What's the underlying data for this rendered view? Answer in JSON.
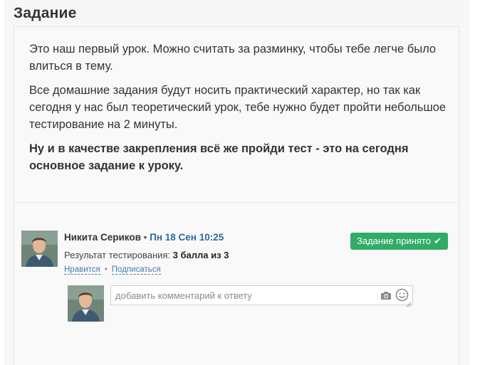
{
  "section": {
    "title": "Задание"
  },
  "task": {
    "paragraphs": [
      "Это наш первый урок. Можно считать за разминку, чтобы тебе легче было влиться в тему.",
      "Все домашние задания будут носить практический характер, но так как сегодня у нас был теоретический урок, тебе нужно будет пройти небольшое тестирование на 2 минуты."
    ],
    "bold_paragraph": "Ну и в качестве закрепления всё же пройди тест - это на сегодня основное задание к уроку."
  },
  "answer": {
    "author_name": "Никита Сериков",
    "separator": "•",
    "date": "Пн 18 Сен 10:25",
    "result_label": "Результат тестирования:",
    "result_value": "3 балла из 3",
    "like_link": "Нравится",
    "link_separator": "•",
    "subscribe_link": "Подписаться",
    "status_badge": "Задание принято",
    "status_color": "#2fac66",
    "link_color": "#2a6aa3"
  },
  "comment": {
    "placeholder": "добавить комментарий к ответу",
    "value": "",
    "icons": [
      "camera-icon",
      "smile-icon"
    ]
  }
}
